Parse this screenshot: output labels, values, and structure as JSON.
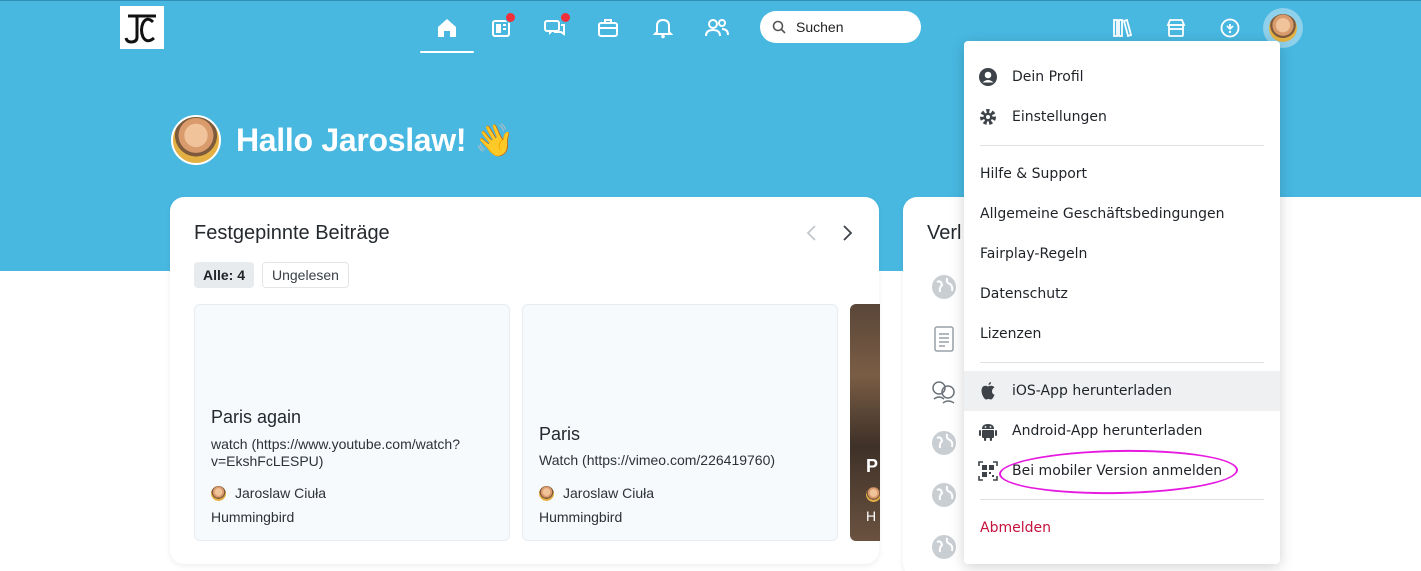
{
  "header": {
    "search_placeholder": "Suchen",
    "nav_icons": [
      "home-icon",
      "feed-icon",
      "chat-icon",
      "briefcase-icon",
      "bell-icon",
      "people-icon"
    ],
    "right_icons": [
      "library-icon",
      "store-icon",
      "info-icon"
    ]
  },
  "greeting": {
    "text": "Hallo Jaroslaw! 👋"
  },
  "pinned": {
    "title": "Festgepinnte Beiträge",
    "filters": [
      {
        "label": "Alle: 4",
        "active": true
      },
      {
        "label": "Ungelesen",
        "active": false
      }
    ],
    "posts": [
      {
        "title": "Paris again",
        "body": "watch (https://www.youtube.com/watch?v=EkshFcLESPU)",
        "author": "Jaroslaw Ciuła",
        "group": "Hummingbird"
      },
      {
        "title": "Paris",
        "body": "Watch (https://vimeo.com/226419760)",
        "author": "Jaroslaw Ciuła",
        "group": "Hummingbird"
      }
    ],
    "partial_card": {
      "letter": "P",
      "group_initial": "H"
    }
  },
  "side_card": {
    "title_partial": "Verl"
  },
  "user_menu": {
    "items": [
      {
        "icon": "user-circle-icon",
        "label": "Dein Profil"
      },
      {
        "icon": "gear-icon",
        "label": "Einstellungen"
      },
      {
        "label": "Hilfe & Support"
      },
      {
        "label": "Allgemeine Geschäftsbedingungen"
      },
      {
        "label": "Fairplay-Regeln"
      },
      {
        "label": "Datenschutz"
      },
      {
        "label": "Lizenzen"
      },
      {
        "icon": "apple-icon",
        "label": "iOS-App herunterladen"
      },
      {
        "icon": "android-icon",
        "label": "Android-App herunterladen"
      },
      {
        "icon": "qr-code-icon",
        "label": "Bei mobiler Version anmelden"
      },
      {
        "label": "Abmelden"
      }
    ],
    "logout_color": "#c4123c",
    "highlight_color": "#e619e0"
  },
  "colors": {
    "hero": "#48b8e1",
    "notification": "#f0303a"
  }
}
